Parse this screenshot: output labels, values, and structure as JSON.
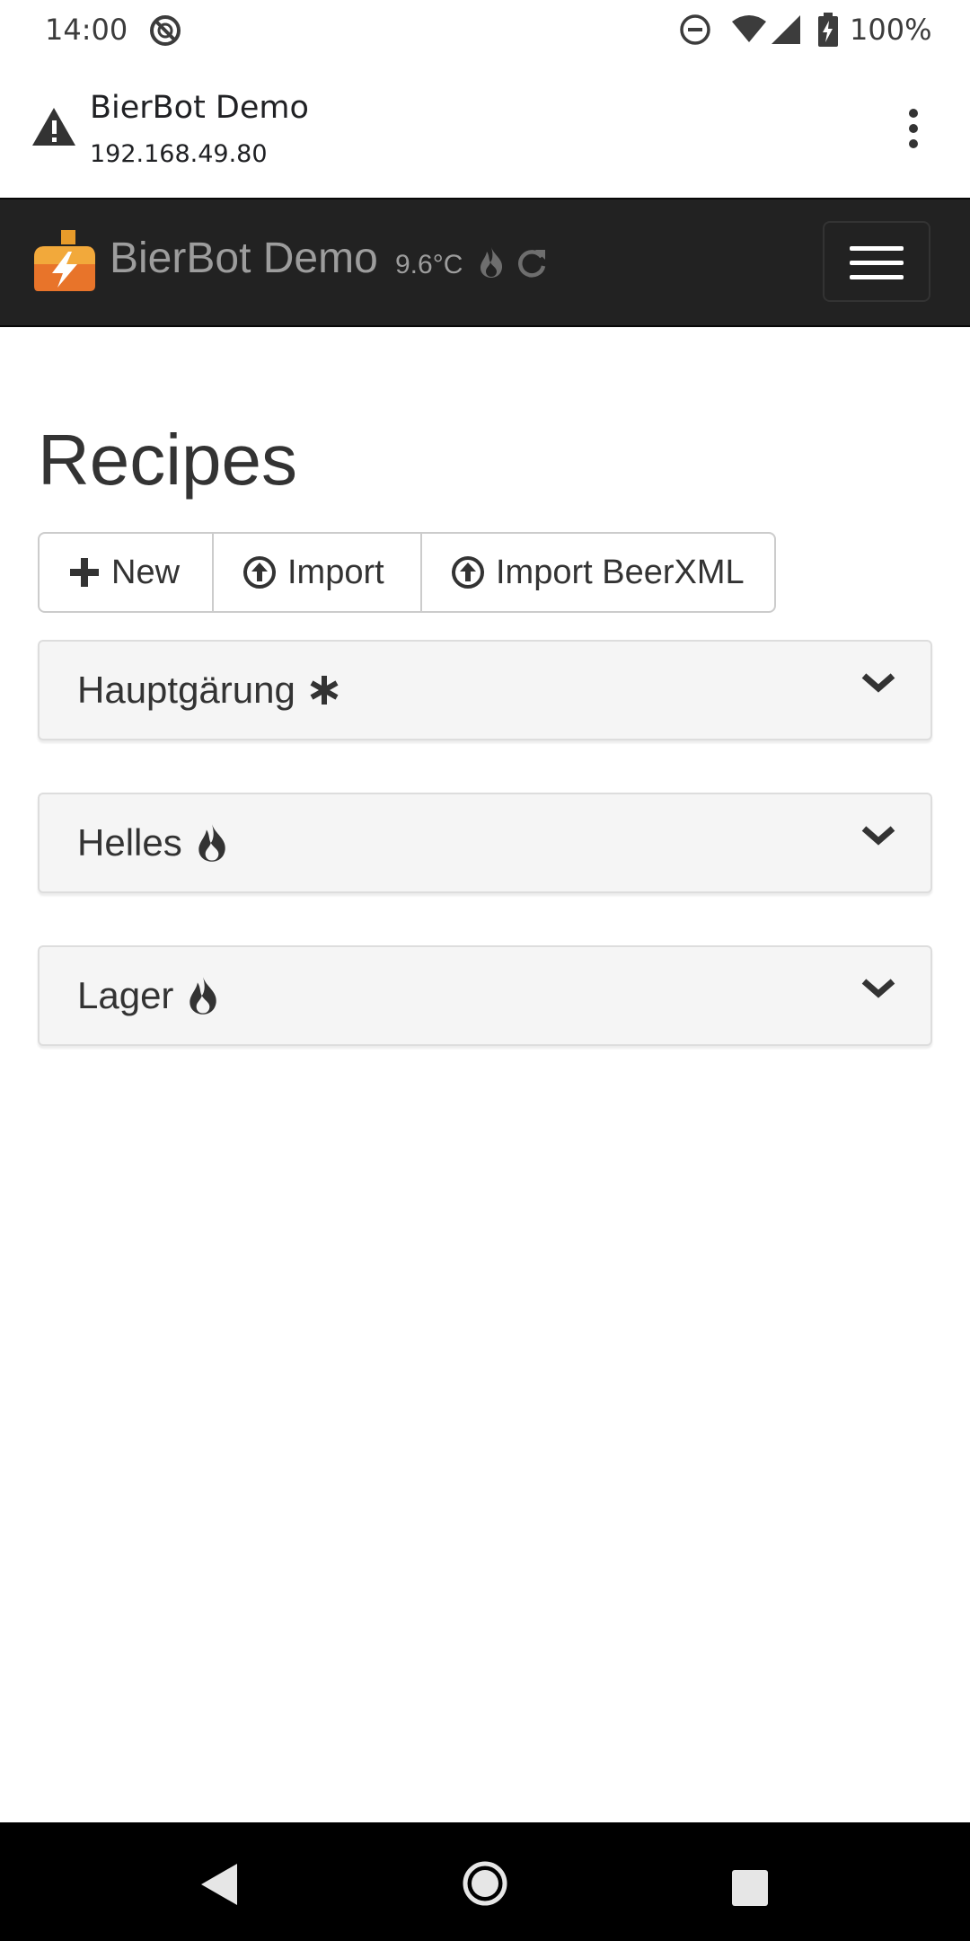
{
  "status_bar": {
    "time": "14:00",
    "battery": "100%",
    "icons": [
      "sync-disabled-icon",
      "do-not-disturb-icon",
      "wifi-icon",
      "signal-icon",
      "battery-charging-icon"
    ]
  },
  "browser": {
    "page_title": "BierBot Demo",
    "url": "192.168.49.80",
    "security_icon": "warning-icon",
    "menu_icon": "more-vert-icon"
  },
  "navbar": {
    "brand": "BierBot Demo",
    "temperature": "9.6°C",
    "icons": [
      "brewery-logo-icon",
      "flame-icon",
      "refresh-icon",
      "hamburger-icon"
    ]
  },
  "main": {
    "heading": "Recipes",
    "buttons": [
      {
        "label": "New",
        "icon": "plus-icon"
      },
      {
        "label": "Import",
        "icon": "circle-arrow-up-icon"
      },
      {
        "label": "Import BeerXML",
        "icon": "circle-arrow-up-icon"
      }
    ],
    "recipes": [
      {
        "name": "Hauptgärung",
        "icon": "snowflake-icon"
      },
      {
        "name": "Helles",
        "icon": "flame-icon"
      },
      {
        "name": "Lager",
        "icon": "flame-icon"
      }
    ]
  },
  "colors": {
    "navbar_bg": "#222222",
    "navbar_text": "#9d9d9d",
    "panel_bg": "#f5f5f5",
    "text": "#333333"
  }
}
